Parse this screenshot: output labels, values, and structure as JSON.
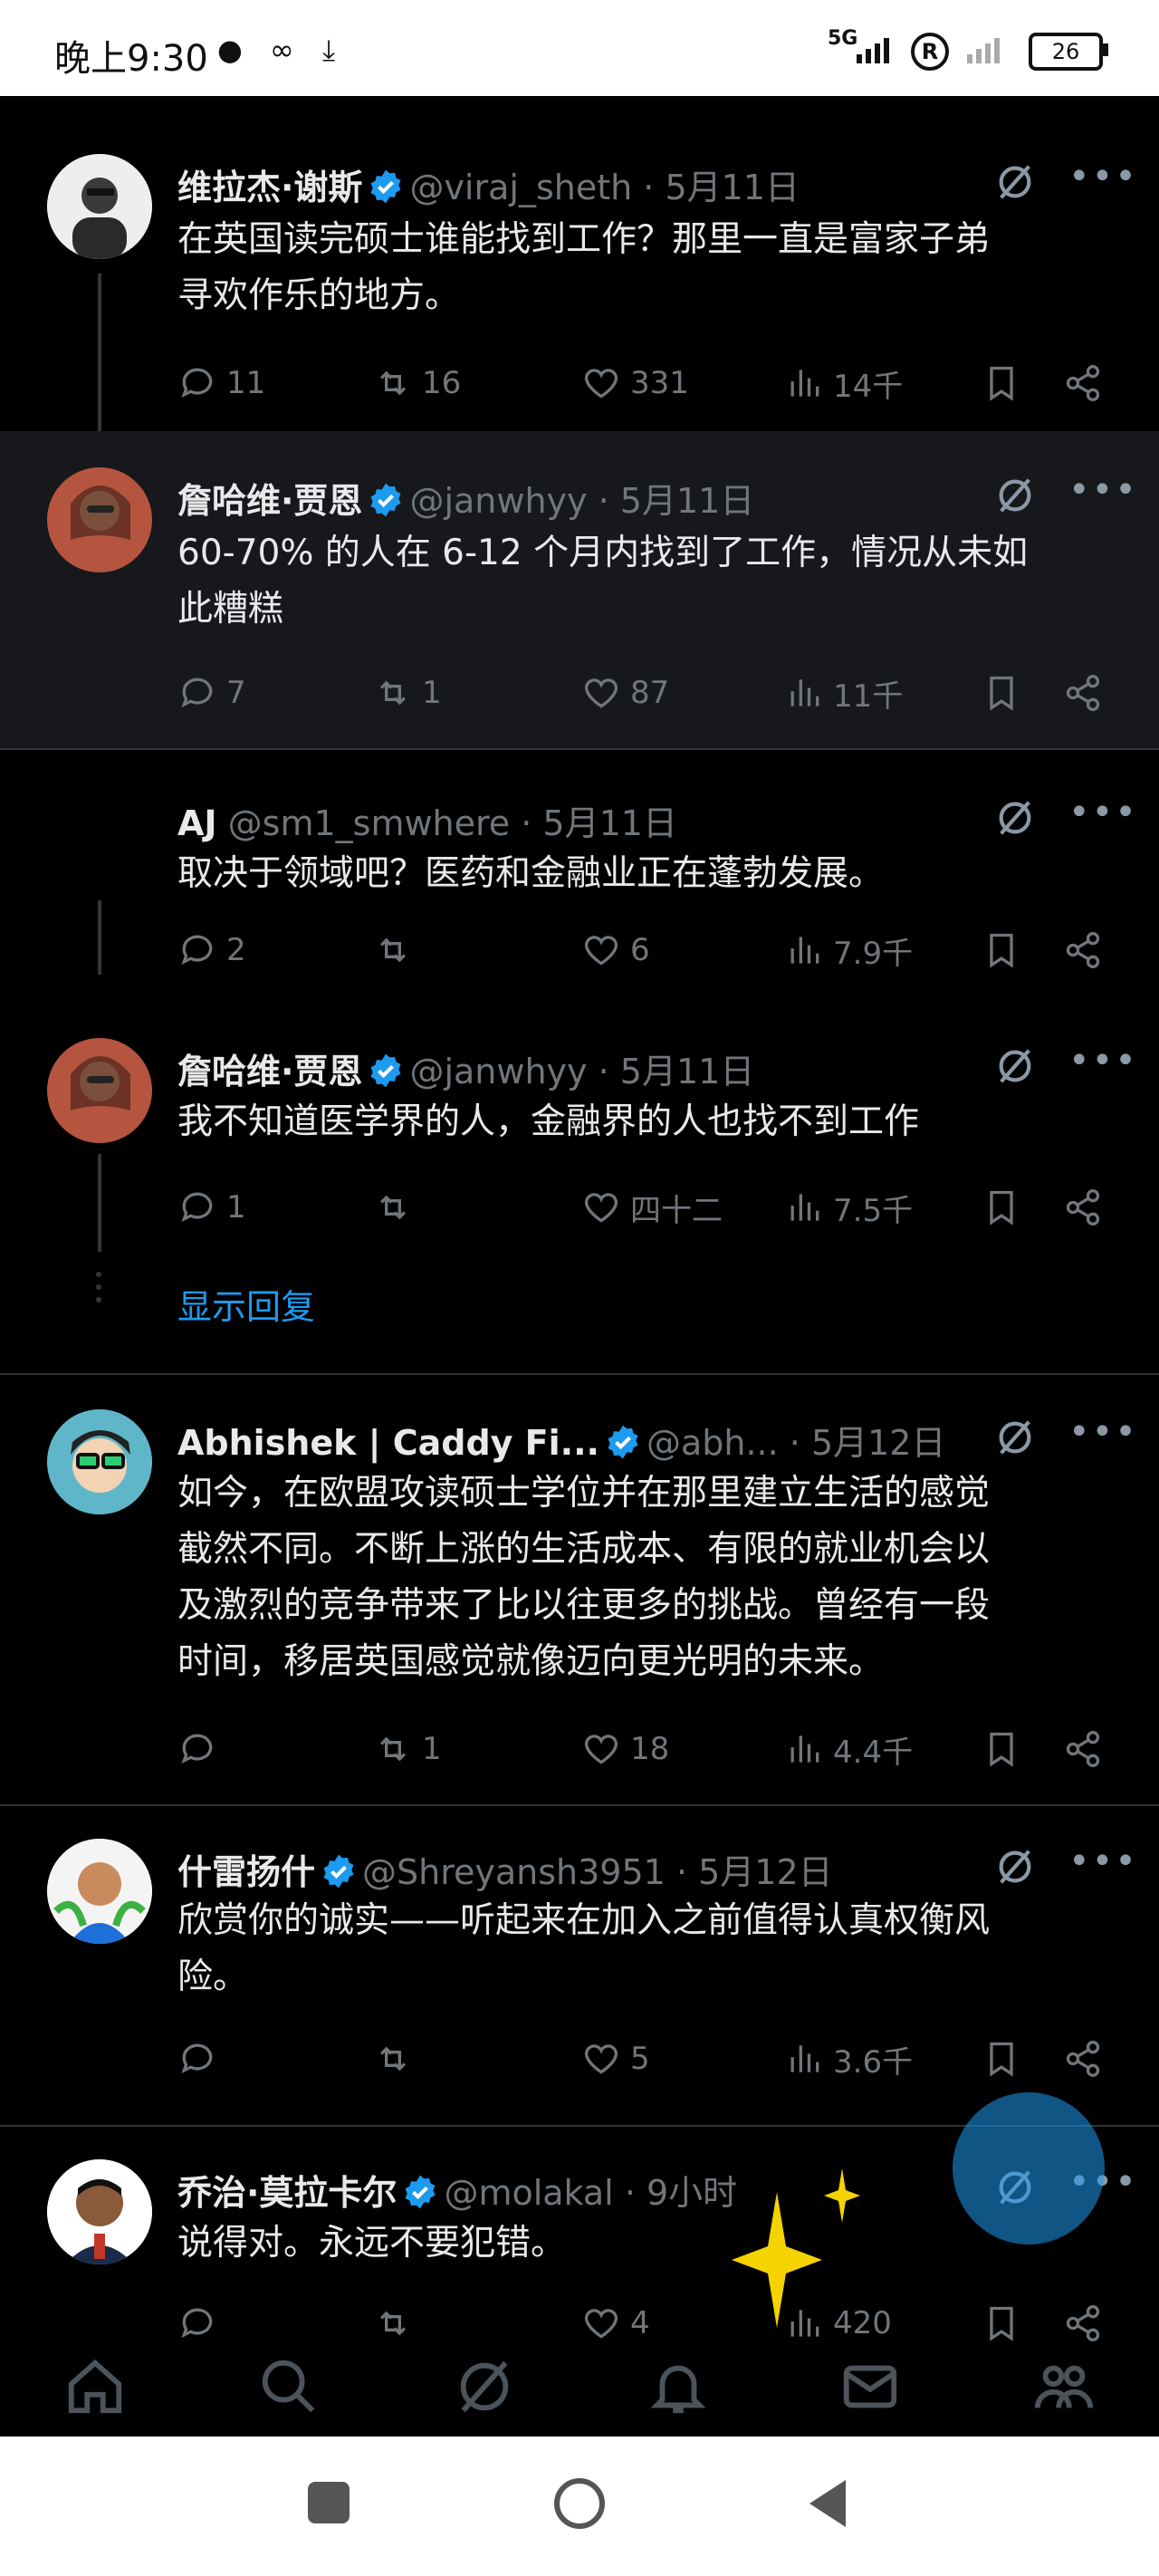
{
  "status_bar": {
    "time": "晚上9:30",
    "network": "5G",
    "battery": "26"
  },
  "posts": [
    {
      "name": "维拉杰·谢斯",
      "handle": "@viraj_sheth",
      "date": "5月11日",
      "verified": true,
      "text": [
        "在英国读完硕士谁能找到工作？那里一直是富家子弟",
        "寻欢作乐的地方。"
      ],
      "replies": "11",
      "retweets": "16",
      "likes": "331",
      "views": "14千"
    },
    {
      "name": "詹哈维·贾恩",
      "handle": "@janwhyy",
      "date": "5月11日",
      "verified": true,
      "text": [
        "60-70% 的人在 6-12 个月内找到了工作，情况从未如",
        "此糟糕"
      ],
      "replies": "7",
      "retweets": "1",
      "likes": "87",
      "views": "11千"
    },
    {
      "name": "AJ",
      "handle": "@sm1_smwhere",
      "date": "5月11日",
      "verified": false,
      "text": [
        "取决于领域吧？医药和金融业正在蓬勃发展。"
      ],
      "replies": "2",
      "retweets": "",
      "likes": "6",
      "views": "7.9千"
    },
    {
      "name": "詹哈维·贾恩",
      "handle": "@janwhyy",
      "date": "5月11日",
      "verified": true,
      "text": [
        "我不知道医学界的人，金融界的人也找不到工作"
      ],
      "replies": "1",
      "retweets": "",
      "likes": "四十二",
      "views": "7.5千"
    },
    {
      "name": "Abhishek | Caddy Fi...",
      "handle": "@abh...",
      "date": "5月12日",
      "verified": true,
      "text": [
        "如今，在欧盟攻读硕士学位并在那里建立生活的感觉",
        "截然不同。不断上涨的生活成本、有限的就业机会以",
        "及激烈的竞争带来了比以往更多的挑战。曾经有一段",
        "时间，移居英国感觉就像迈向更光明的未来。"
      ],
      "replies": "",
      "retweets": "1",
      "likes": "18",
      "views": "4.4千"
    },
    {
      "name": "什雷扬什",
      "handle": "@Shreyansh3951",
      "date": "5月12日",
      "verified": true,
      "text": [
        "欣赏你的诚实——听起来在加入之前值得认真权衡风",
        "险。"
      ],
      "replies": "",
      "retweets": "",
      "likes": "5",
      "views": "3.6千"
    },
    {
      "name": "乔治·莫拉卡尔",
      "handle": "@molakal",
      "date": "9小时",
      "verified": true,
      "text": [
        "说得对。永远不要犯错。"
      ],
      "replies": "",
      "retweets": "",
      "likes": "4",
      "views": "420"
    }
  ],
  "show_replies": "显示回复",
  "colors": {
    "accent": "#1d9bf0",
    "background": "#000000",
    "muted_text": "#71767b"
  },
  "icons": [
    "reply-icon",
    "retweet-icon",
    "like-icon",
    "views-icon",
    "bookmark-icon",
    "share-icon",
    "grok-icon",
    "more-icon",
    "home-icon",
    "search-icon",
    "notifications-icon",
    "messages-icon",
    "communities-icon"
  ]
}
